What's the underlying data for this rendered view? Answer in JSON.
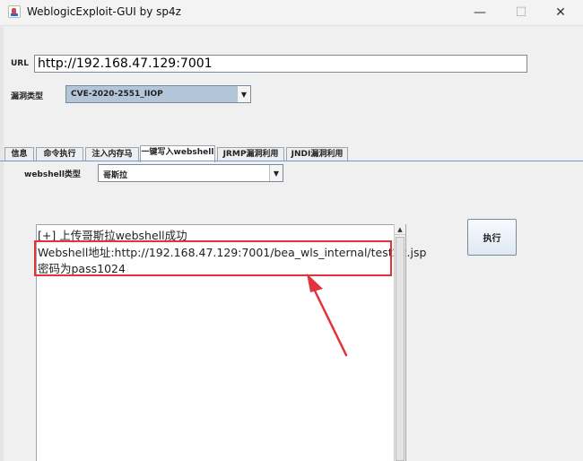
{
  "window": {
    "title": "WeblogicExploit-GUI by sp4z",
    "minimize_glyph": "—",
    "maximize_glyph": "☐",
    "close_glyph": "✕"
  },
  "url": {
    "label": "URL",
    "value": "http://192.168.47.129:7001"
  },
  "vuln": {
    "label": "漏洞类型",
    "selected": "CVE-2020-2551_IIOP"
  },
  "tabs": [
    {
      "label": "信息"
    },
    {
      "label": "命令执行"
    },
    {
      "label": "注入内存马"
    },
    {
      "label": "一键写入webshell",
      "active": true
    },
    {
      "label": "JRMP漏洞利用"
    },
    {
      "label": "JNDI漏洞利用"
    }
  ],
  "webshell": {
    "label": "webshell类型",
    "selected": "哥斯拉"
  },
  "output": {
    "lines": [
      "[+] 上传哥斯拉webshell成功",
      "Webshell地址:http://192.168.47.129:7001/bea_wls_internal/test22.jsp",
      "密码为pass1024"
    ]
  },
  "execute_button": {
    "label": "执行"
  },
  "annotation": {
    "color": "#e2323a"
  }
}
